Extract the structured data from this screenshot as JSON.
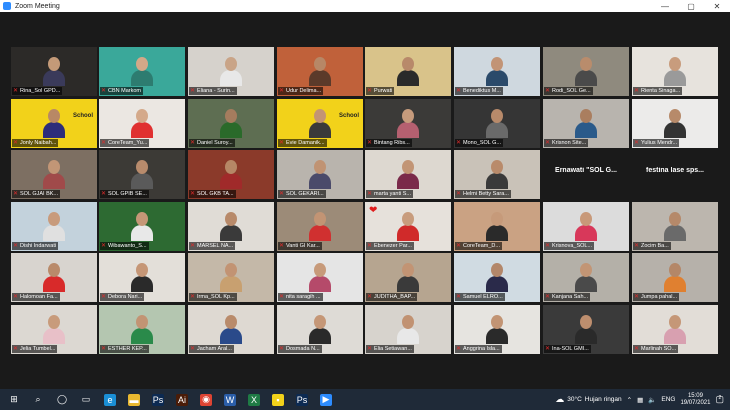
{
  "window": {
    "title": "Zoom Meeting",
    "minimize": "—",
    "maximize": "▢",
    "close": "✕"
  },
  "colors": {
    "speaking_border": "#e8e000",
    "muted_mic": "#e02b2b",
    "taskbar": "#1f2a38",
    "stage": "#1a1a1a"
  },
  "grid": [
    [
      {
        "name": "Rina_Sol GPD...",
        "bg": "#2c2a28",
        "skin": "#c49a78",
        "shirt": "#3a3a5a"
      },
      {
        "name": "CBN Markom",
        "bg": "#3aa89a",
        "skin": "#d3a888",
        "shirt": "#2d7c70"
      },
      {
        "name": "Eliana - Surin...",
        "bg": "#d6d2cc",
        "skin": "#c9a487",
        "shirt": "#e8e8e8"
      },
      {
        "name": "Udur Delima...",
        "bg": "#c0613a",
        "skin": "#b78766",
        "shirt": "#5b3a2a"
      },
      {
        "name": "Purwati",
        "bg": "#d9c38a",
        "skin": "#b8896a",
        "shirt": "#2a2a2a",
        "speaking": true
      },
      {
        "name": "Benediktus M...",
        "bg": "#cfd8df",
        "skin": "#c29476",
        "shirt": "#2b4a6a"
      },
      {
        "name": "Rodi_SOL Ge...",
        "bg": "#8f8a7e",
        "skin": "#b98c6c",
        "shirt": "#4a4a4a"
      },
      {
        "name": "Rienta Sinaga...",
        "bg": "#e7e3dd",
        "skin": "#c89c7d",
        "shirt": "#9a9a9a"
      }
    ],
    [
      {
        "name": "Jonly Naibah...",
        "bg": "#f2d21a",
        "skin": "#b88865",
        "shirt": "#2d2d7a",
        "sign": "School"
      },
      {
        "name": "CoreTeam_Yu...",
        "bg": "#ebe7e2",
        "skin": "#d4a98a",
        "shirt": "#e03030"
      },
      {
        "name": "Daniel Suroy...",
        "bg": "#5e6e52",
        "skin": "#a57c5e",
        "shirt": "#2a6a2a"
      },
      {
        "name": "Evie Damanik...",
        "bg": "#f2d21a",
        "skin": "#c39474",
        "shirt": "#3a3a3a",
        "sign": "School"
      },
      {
        "name": "Bintang Ribs...",
        "bg": "#3b3a38",
        "skin": "#c69b7c",
        "shirt": "#b56070"
      },
      {
        "name": "Mono_SOL G...",
        "bg": "#353535",
        "skin": "#b88a6a",
        "shirt": "#6a6a6a"
      },
      {
        "name": "Krisnon Site...",
        "bg": "#b8b4ae",
        "skin": "#aa7e5f",
        "shirt": "#2a5a8a"
      },
      {
        "name": "Yulius Mendr...",
        "bg": "#ecebea",
        "skin": "#b78a6a",
        "shirt": "#333333"
      }
    ],
    [
      {
        "name": "SOL GJAI BK...",
        "bg": "#7d6f62",
        "skin": "#c29676",
        "shirt": "#a04a4a"
      },
      {
        "name": "SOL GPIB SE...",
        "bg": "#3c3a36",
        "skin": "#b88b6c",
        "shirt": "#5a5a5a"
      },
      {
        "name": "SOL GKB TA...",
        "bg": "#8b3a2a",
        "skin": "#b68766",
        "shirt": "#a02a2a"
      },
      {
        "name": "SOL GEKARI...",
        "bg": "#b9b4ad",
        "skin": "#c09373",
        "shirt": "#4a4a6a"
      },
      {
        "name": "marta yanti S...",
        "bg": "#ddd8d0",
        "skin": "#c29575",
        "shirt": "#7a2a4a"
      },
      {
        "name": "Helmi Betty Sara...",
        "bg": "#c9c2b8",
        "skin": "#b98b6b",
        "shirt": "#3a3a3a"
      },
      {
        "name": "Ernawati \"SOL G...",
        "bg": "",
        "name_only": true
      },
      {
        "name": "festina lase sps...",
        "bg": "",
        "name_only": true
      }
    ],
    [
      {
        "name": "Dishi Indarwati",
        "bg": "#c3d2dc",
        "skin": "#c89b7c",
        "shirt": "#e0e0e0"
      },
      {
        "name": "Wibawanto_S...",
        "bg": "#2d6a32",
        "skin": "#c59777",
        "shirt": "#e8e8e8"
      },
      {
        "name": "MARSEL NA...",
        "bg": "#e0dcd6",
        "skin": "#b88a6a",
        "shirt": "#3a3a3a"
      },
      {
        "name": "Vanti GI Kar...",
        "bg": "#9c8b78",
        "skin": "#c29474",
        "shirt": "#d03030"
      },
      {
        "name": "Ebenezer Par...",
        "bg": "#e6e1db",
        "skin": "#c89c7d",
        "shirt": "#d02a2a",
        "heart": true
      },
      {
        "name": "CoreTeam_D...",
        "bg": "#caa283",
        "skin": "#c69a7a",
        "shirt": "#2a2a2a"
      },
      {
        "name": "Krisnova_SOL...",
        "bg": "#dcdcdc",
        "skin": "#c89979",
        "shirt": "#d8385a"
      },
      {
        "name": "Zocim Ba...",
        "bg": "#bcb6ae",
        "skin": "#b5896a",
        "shirt": "#6a6a6a"
      }
    ],
    [
      {
        "name": "Halomoan Fa...",
        "bg": "#d8d4cf",
        "skin": "#b98a6a",
        "shirt": "#d82a2a"
      },
      {
        "name": "Debora Nari...",
        "bg": "#e3dfd9",
        "skin": "#c59676",
        "shirt": "#2a2a2a"
      },
      {
        "name": "Irma_SOL Kp...",
        "bg": "#c4b8a8",
        "skin": "#c29373",
        "shirt": "#c8a070"
      },
      {
        "name": "nita saragih ...",
        "bg": "#e5e5e5",
        "skin": "#c79a7a",
        "shirt": "#b54a6a"
      },
      {
        "name": "JUDITHA_BAP...",
        "bg": "#b6a590",
        "skin": "#c29474",
        "shirt": "#3a3a3a"
      },
      {
        "name": "Samuel ELRO...",
        "bg": "#d0dbe2",
        "skin": "#b3876a",
        "shirt": "#2a2a4a"
      },
      {
        "name": "Kanjana Sah...",
        "bg": "#b4b0a8",
        "skin": "#c29575",
        "shirt": "#4a4a4a"
      },
      {
        "name": "Jumpa pahal...",
        "bg": "#b6b1aa",
        "skin": "#b48768",
        "shirt": "#e08030"
      }
    ],
    [
      {
        "name": "Jelia Tumbel...",
        "bg": "#dcd8d2",
        "skin": "#c89b7b",
        "shirt": "#e8c0c8"
      },
      {
        "name": "ESTHER KEP...",
        "bg": "#b4c6b0",
        "skin": "#c29474",
        "shirt": "#2a8a4a"
      },
      {
        "name": "Jacham Aral...",
        "bg": "#ded9d2",
        "skin": "#b98b6b",
        "shirt": "#2a4a8a"
      },
      {
        "name": "Dosmada N...",
        "bg": "#dedbd6",
        "skin": "#c59777",
        "shirt": "#2a2a2a"
      },
      {
        "name": "Elia Setiawan...",
        "bg": "#d7d3cd",
        "skin": "#c19272",
        "shirt": "#e8e8e8"
      },
      {
        "name": "Anggrina Isla...",
        "bg": "#e6e4e0",
        "skin": "#c29474",
        "shirt": "#2a2a2a"
      },
      {
        "name": "Ina-SOL GMI...",
        "bg": "#3a3a3a",
        "skin": "#bd8e6e",
        "shirt": "#2a2a2a"
      },
      {
        "name": "Marlinah SO...",
        "bg": "#e2ddd7",
        "skin": "#c59777",
        "shirt": "#d8a0b0"
      }
    ]
  ],
  "taskbar": {
    "icons": [
      {
        "name": "windows-start-icon",
        "glyph": "⊞",
        "bg": "transparent"
      },
      {
        "name": "search-icon",
        "glyph": "⌕",
        "bg": "transparent"
      },
      {
        "name": "cortana-icon",
        "glyph": "◯",
        "bg": "transparent"
      },
      {
        "name": "task-view-icon",
        "glyph": "▭",
        "bg": "transparent"
      },
      {
        "name": "edge-icon",
        "glyph": "e",
        "bg": "#1a8fd6"
      },
      {
        "name": "file-explorer-icon",
        "glyph": "▬",
        "bg": "#e8b830"
      },
      {
        "name": "photoshop-icon",
        "glyph": "Ps",
        "bg": "#0c2a52"
      },
      {
        "name": "illustrator-icon",
        "glyph": "Ai",
        "bg": "#4a1c08"
      },
      {
        "name": "chrome-icon",
        "glyph": "◉",
        "bg": "#dd4433"
      },
      {
        "name": "word-icon",
        "glyph": "W",
        "bg": "#2b5ea8"
      },
      {
        "name": "excel-icon",
        "glyph": "X",
        "bg": "#1f7a45"
      },
      {
        "name": "sticky-notes-icon",
        "glyph": "▪",
        "bg": "#f2d21a"
      },
      {
        "name": "photoshop-2-icon",
        "glyph": "Ps",
        "bg": "#0c2a52"
      },
      {
        "name": "zoom-app-icon",
        "glyph": "▶",
        "bg": "#2d8cff"
      }
    ],
    "weather_temp": "30°C",
    "weather_desc": "Hujan ringan",
    "lang": "ENG",
    "time": "15:09",
    "date": "19/07/2021",
    "notification_count": "2"
  }
}
